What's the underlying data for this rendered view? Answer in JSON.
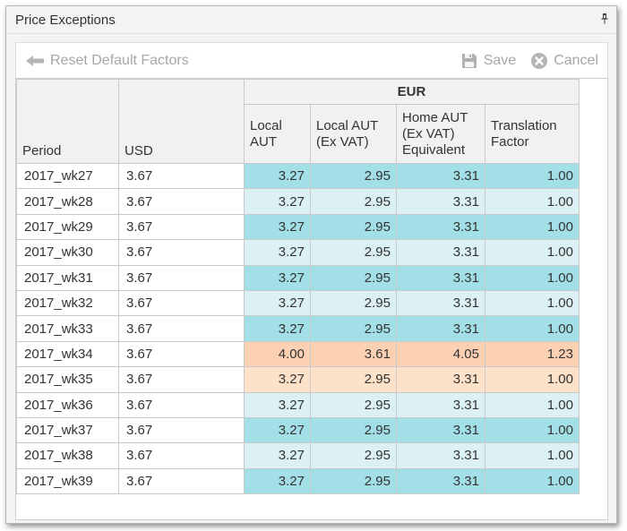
{
  "window": {
    "title": "Price Exceptions",
    "pin_glyph": "📌"
  },
  "toolbar": {
    "reset_label": "Reset Default Factors",
    "save_label": "Save",
    "cancel_label": "Cancel"
  },
  "grid": {
    "group_header": "EUR",
    "columns": {
      "period": "Period",
      "usd": "USD",
      "local_aut": [
        "Local",
        "AUT"
      ],
      "local_aut_ex": [
        "Local AUT",
        "(Ex VAT)"
      ],
      "home_aut": [
        "Home AUT",
        "(Ex VAT)",
        "Equivalent"
      ],
      "translation": [
        "Translation",
        "Factor"
      ]
    },
    "rows": [
      {
        "period": "2017_wk27",
        "usd": "3.67",
        "local_aut": "3.27",
        "local_aut_ex": "2.95",
        "home_aut": "3.31",
        "translation": "1.00",
        "style": "a"
      },
      {
        "period": "2017_wk28",
        "usd": "3.67",
        "local_aut": "3.27",
        "local_aut_ex": "2.95",
        "home_aut": "3.31",
        "translation": "1.00",
        "style": "b"
      },
      {
        "period": "2017_wk29",
        "usd": "3.67",
        "local_aut": "3.27",
        "local_aut_ex": "2.95",
        "home_aut": "3.31",
        "translation": "1.00",
        "style": "a"
      },
      {
        "period": "2017_wk30",
        "usd": "3.67",
        "local_aut": "3.27",
        "local_aut_ex": "2.95",
        "home_aut": "3.31",
        "translation": "1.00",
        "style": "b"
      },
      {
        "period": "2017_wk31",
        "usd": "3.67",
        "local_aut": "3.27",
        "local_aut_ex": "2.95",
        "home_aut": "3.31",
        "translation": "1.00",
        "style": "a"
      },
      {
        "period": "2017_wk32",
        "usd": "3.67",
        "local_aut": "3.27",
        "local_aut_ex": "2.95",
        "home_aut": "3.31",
        "translation": "1.00",
        "style": "b"
      },
      {
        "period": "2017_wk33",
        "usd": "3.67",
        "local_aut": "3.27",
        "local_aut_ex": "2.95",
        "home_aut": "3.31",
        "translation": "1.00",
        "style": "a"
      },
      {
        "period": "2017_wk34",
        "usd": "3.67",
        "local_aut": "4.00",
        "local_aut_ex": "3.61",
        "home_aut": "4.05",
        "translation": "1.23",
        "style": "hi"
      },
      {
        "period": "2017_wk35",
        "usd": "3.67",
        "local_aut": "3.27",
        "local_aut_ex": "2.95",
        "home_aut": "3.31",
        "translation": "1.00",
        "style": "hi2"
      },
      {
        "period": "2017_wk36",
        "usd": "3.67",
        "local_aut": "3.27",
        "local_aut_ex": "2.95",
        "home_aut": "3.31",
        "translation": "1.00",
        "style": "b"
      },
      {
        "period": "2017_wk37",
        "usd": "3.67",
        "local_aut": "3.27",
        "local_aut_ex": "2.95",
        "home_aut": "3.31",
        "translation": "1.00",
        "style": "a"
      },
      {
        "period": "2017_wk38",
        "usd": "3.67",
        "local_aut": "3.27",
        "local_aut_ex": "2.95",
        "home_aut": "3.31",
        "translation": "1.00",
        "style": "b"
      },
      {
        "period": "2017_wk39",
        "usd": "3.67",
        "local_aut": "3.27",
        "local_aut_ex": "2.95",
        "home_aut": "3.31",
        "translation": "1.00",
        "style": "a"
      }
    ]
  },
  "colors": {
    "row_a": "#a3dfe6",
    "row_b": "#dcf1f4",
    "row_exception": "#fbd0b3",
    "row_exception_light": "#fde2c9",
    "disabled_text": "#a7a7a7"
  },
  "icons": {
    "reset": "arrow-left-icon",
    "save": "floppy-disk-icon",
    "cancel": "cancel-circle-icon",
    "pin": "pin-icon"
  }
}
